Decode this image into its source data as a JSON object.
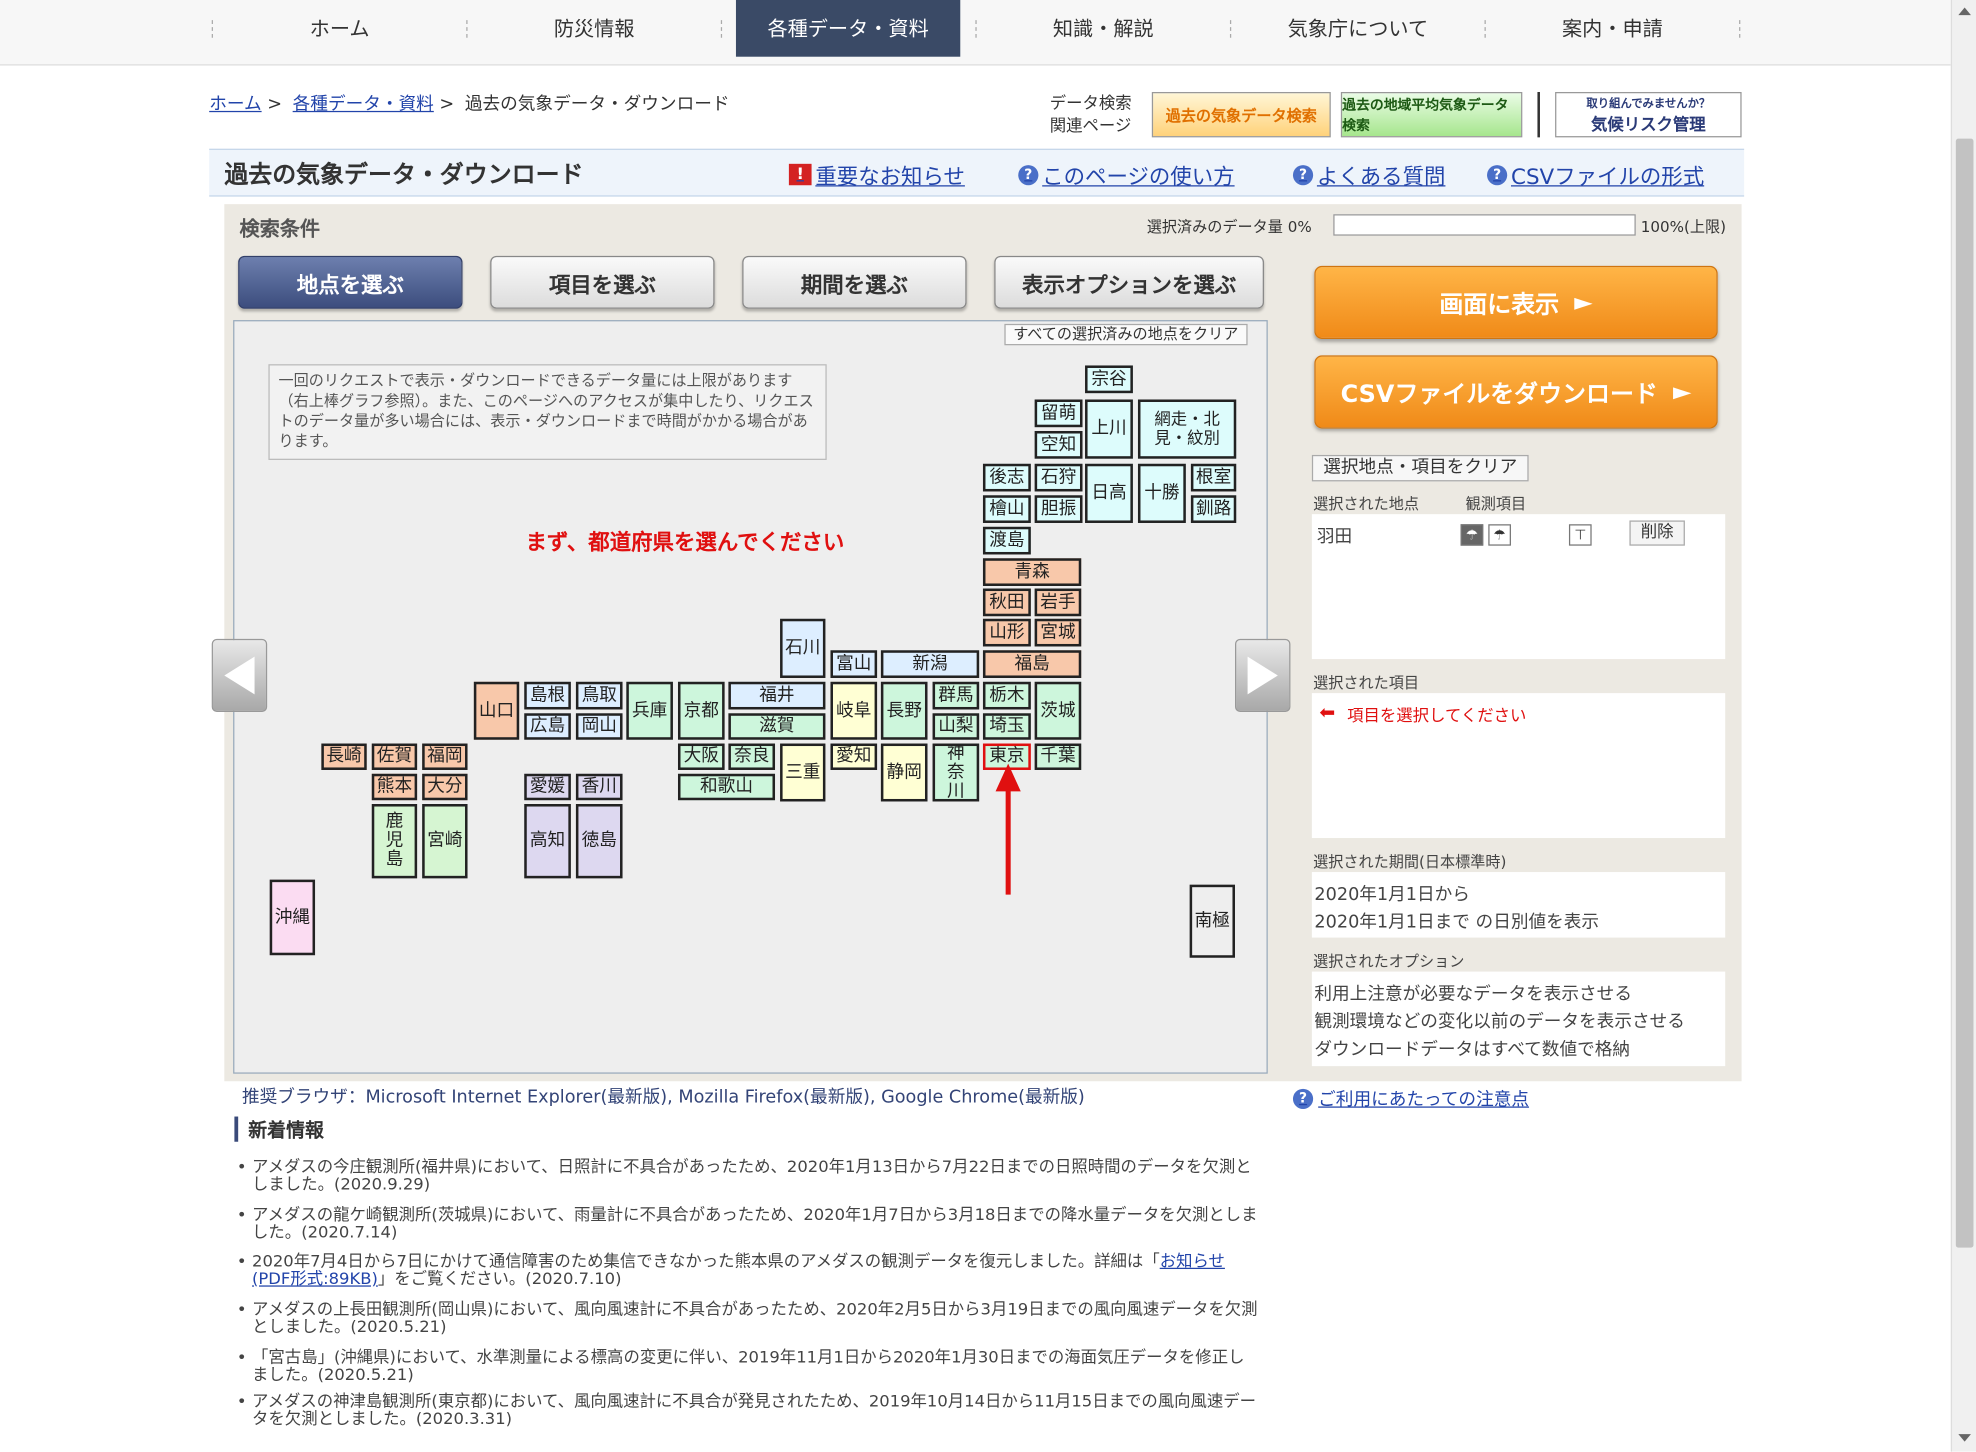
{
  "nav": {
    "items": [
      "ホーム",
      "防災情報",
      "各種データ・資料",
      "知識・解説",
      "気象庁について",
      "案内・申請"
    ],
    "active_index": 2
  },
  "breadcrumb": {
    "home": "ホーム",
    "data": "各種データ・資料",
    "sep": ">",
    "current": "過去の気象データ・ダウンロード"
  },
  "related": {
    "label1": "データ検索",
    "label2": "関連ページ",
    "banner_past": "過去の気象データ検索",
    "banner_area": "過去の地域平均気象データ検索",
    "banner_risk_top": "取り組んでみませんか？",
    "banner_risk_main": "気候リスク管理"
  },
  "header": {
    "title": "過去の気象データ・ダウンロード",
    "links": [
      "重要なお知らせ",
      "このページの使い方",
      "よくある質問",
      "CSVファイルの形式"
    ]
  },
  "search": {
    "heading": "検索条件",
    "data_amount_label": "選択済みのデータ量 0%",
    "data_amount_percent": 0,
    "data_limit_label": "100%(上限)",
    "tabs": [
      "地点を選ぶ",
      "項目を選ぶ",
      "期間を選ぶ",
      "表示オプションを選ぶ"
    ],
    "active_tab": 0,
    "clear_all": "すべての選択済みの地点をクリア",
    "notice": "一回のリクエストで表示・ダウンロードできるデータ量には上限があります（右上棒グラフ参照）。また、このページへのアクセスが集中したり、リクエストのデータ量が多い場合には、表示・ダウンロードまで時間がかかる場合があります。",
    "instruction": "まず、都道府県を選んでください"
  },
  "prefectures": [
    {
      "name": "宗谷",
      "color": "cyan"
    },
    {
      "name": "留萌",
      "color": "cyan"
    },
    {
      "name": "空知",
      "color": "cyan"
    },
    {
      "name": "上川",
      "color": "cyan"
    },
    {
      "name": "網走・北見・紋別",
      "color": "cyan"
    },
    {
      "name": "後志",
      "color": "cyan"
    },
    {
      "name": "石狩",
      "color": "cyan"
    },
    {
      "name": "日高",
      "color": "cyan"
    },
    {
      "name": "十勝",
      "color": "cyan"
    },
    {
      "name": "根室",
      "color": "cyan"
    },
    {
      "name": "檜山",
      "color": "cyan"
    },
    {
      "name": "胆振",
      "color": "cyan"
    },
    {
      "name": "釧路",
      "color": "cyan"
    },
    {
      "name": "渡島",
      "color": "cyan"
    },
    {
      "name": "青森",
      "color": "salmon"
    },
    {
      "name": "秋田",
      "color": "salmon"
    },
    {
      "name": "岩手",
      "color": "salmon"
    },
    {
      "name": "山形",
      "color": "salmon"
    },
    {
      "name": "宮城",
      "color": "salmon"
    },
    {
      "name": "福島",
      "color": "salmon"
    },
    {
      "name": "石川",
      "color": "blue"
    },
    {
      "name": "富山",
      "color": "blue"
    },
    {
      "name": "新潟",
      "color": "blue"
    },
    {
      "name": "福井",
      "color": "blue"
    },
    {
      "name": "群馬",
      "color": "green"
    },
    {
      "name": "栃木",
      "color": "green"
    },
    {
      "name": "山口",
      "color": "salmon"
    },
    {
      "name": "島根",
      "color": "blue"
    },
    {
      "name": "鳥取",
      "color": "blue"
    },
    {
      "name": "兵庫",
      "color": "green"
    },
    {
      "name": "京都",
      "color": "green"
    },
    {
      "name": "岐阜",
      "color": "yellow"
    },
    {
      "name": "長野",
      "color": "green"
    },
    {
      "name": "茨城",
      "color": "green"
    },
    {
      "name": "広島",
      "color": "blue"
    },
    {
      "name": "岡山",
      "color": "blue"
    },
    {
      "name": "滋賀",
      "color": "green"
    },
    {
      "name": "山梨",
      "color": "green"
    },
    {
      "name": "埼玉",
      "color": "green"
    },
    {
      "name": "長崎",
      "color": "salmon"
    },
    {
      "name": "佐賀",
      "color": "salmon"
    },
    {
      "name": "福岡",
      "color": "salmon"
    },
    {
      "name": "大阪",
      "color": "green"
    },
    {
      "name": "奈良",
      "color": "green"
    },
    {
      "name": "三重",
      "color": "yellow"
    },
    {
      "name": "愛知",
      "color": "yellow"
    },
    {
      "name": "静岡",
      "color": "yellow"
    },
    {
      "name": "神奈川",
      "color": "green"
    },
    {
      "name": "東京",
      "color": "green",
      "selected": true
    },
    {
      "name": "千葉",
      "color": "green"
    },
    {
      "name": "熊本",
      "color": "salmon"
    },
    {
      "name": "大分",
      "color": "salmon"
    },
    {
      "name": "愛媛",
      "color": "lav"
    },
    {
      "name": "香川",
      "color": "lav"
    },
    {
      "name": "和歌山",
      "color": "green"
    },
    {
      "name": "鹿児島",
      "color": "mint"
    },
    {
      "name": "宮崎",
      "color": "mint"
    },
    {
      "name": "高知",
      "color": "lav"
    },
    {
      "name": "徳島",
      "color": "lav"
    },
    {
      "name": "沖縄",
      "color": "pink"
    },
    {
      "name": "南極",
      "color": "none"
    }
  ],
  "actions": {
    "display": "画面に表示",
    "csv": "CSVファイルをダウンロード",
    "arrow": "►"
  },
  "sidebar": {
    "clear_button": "選択地点・項目をクリア",
    "selected_stations_label": "選択された地点",
    "observation_items_label": "観測項目",
    "station": "羽田",
    "delete_button": "削除",
    "selected_items_label": "選択された項目",
    "items_message": "項目を選択してください",
    "period_label": "選択された期間(日本標準時)",
    "period_from": "2020年1月1日から",
    "period_to": "2020年1月1日まで の日別値を表示",
    "options_label": "選択されたオプション",
    "options": [
      "利用上注意が必要なデータを表示させる",
      "観測環境などの変化以前のデータを表示させる",
      "ダウンロードデータはすべて数値で格納"
    ],
    "usage_link": "ご利用にあたっての注意点"
  },
  "browsers": "推奨ブラウザ：Microsoft Internet Explorer(最新版), Mozilla Firefox(最新版), Google Chrome(最新版)",
  "news": {
    "heading": "新着情報",
    "items": [
      "アメダスの今庄観測所(福井県)において、日照計に不具合があったため、2020年1月13日から7月22日までの日照時間のデータを欠測としました。(2020.9.29)",
      "アメダスの龍ケ崎観測所(茨城県)において、雨量計に不具合があったため、2020年1月7日から3月18日までの降水量データを欠測としました。(2020.7.14)",
      "2020年7月4日から7日にかけて通信障害のため集信できなかった熊本県のアメダスの観測データを復元しました。詳細は「",
      "アメダスの上長田観測所(岡山県)において、風向風速計に不具合があったため、2020年2月5日から3月19日までの風向風速データを欠測としました。(2020.5.21)",
      "「宮古島」(沖縄県)において、水準測量による標高の変更に伴い、2019年11月1日から2020年1月30日までの海面気圧データを修正しました。(2020.5.21)",
      "アメダスの神津島観測所(東京都)において、風向風速計に不具合が発見されたため、2019年10月14日から11月15日までの風向風速データを欠測としました。(2020.3.31)"
    ],
    "item3_link": "お知らせ(PDF形式:89KB)",
    "item3_tail": "」をご覧ください。(2020.7.10)"
  },
  "colors": {
    "nav_active": "#3a4a66",
    "accent_orange": "#f08a18",
    "alert_red": "#e01010",
    "link_blue": "#2244aa"
  }
}
